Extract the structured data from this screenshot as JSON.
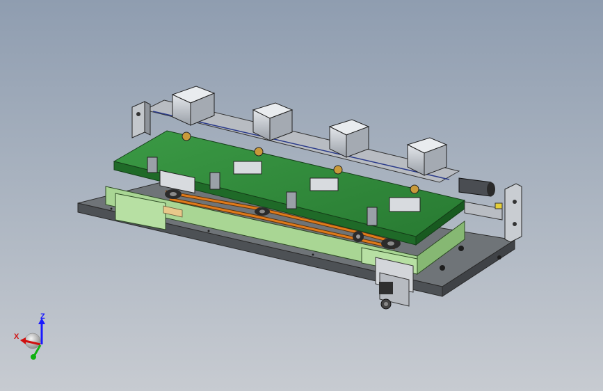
{
  "triad": {
    "z_label": "Z",
    "x_label": "X",
    "z_color": "#1a1aff",
    "x_color": "#d01010",
    "y_color": "#10b010"
  },
  "colors": {
    "background_top": "#8f9db0",
    "background_bottom": "#c7cbd1",
    "base_plate": "#5f6468",
    "frame_green": "#9fcf8a",
    "pcb_green": "#2f8a3a",
    "belt_orange": "#e07a1a",
    "module_steel": "#c8ccd2"
  },
  "scene": {
    "station_count": 4
  }
}
